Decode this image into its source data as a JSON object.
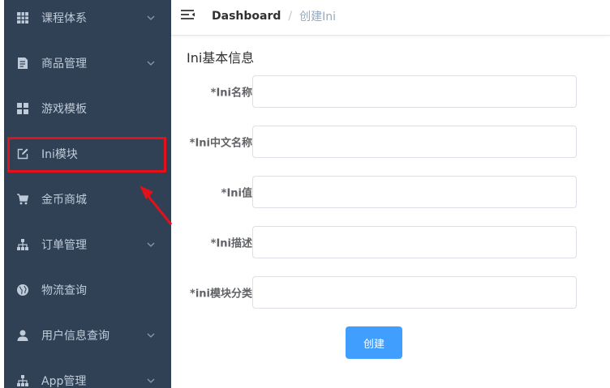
{
  "sidebar": {
    "items": [
      {
        "label": "课程体系",
        "icon": "grid-icon",
        "has_submenu": true
      },
      {
        "label": "商品管理",
        "icon": "document-icon",
        "has_submenu": true
      },
      {
        "label": "游戏模板",
        "icon": "dashboard-icon",
        "has_submenu": false
      },
      {
        "label": "Ini模块",
        "icon": "edit-icon",
        "has_submenu": false,
        "highlighted": true
      },
      {
        "label": "金币商城",
        "icon": "cart-icon",
        "has_submenu": false
      },
      {
        "label": "订单管理",
        "icon": "sitemap-icon",
        "has_submenu": true
      },
      {
        "label": "物流查询",
        "icon": "globe-icon",
        "has_submenu": false
      },
      {
        "label": "用户信息查询",
        "icon": "user-icon",
        "has_submenu": true
      },
      {
        "label": "App管理",
        "icon": "sitemap-icon",
        "has_submenu": true
      }
    ]
  },
  "header": {
    "breadcrumb_home": "Dashboard",
    "breadcrumb_separator": "/",
    "breadcrumb_current": "创建Ini"
  },
  "form": {
    "title": "Ini基本信息",
    "fields": [
      {
        "label": "*Ini名称",
        "value": ""
      },
      {
        "label": "*Ini中文名称",
        "value": ""
      },
      {
        "label": "*Ini值",
        "value": ""
      },
      {
        "label": "*Ini描述",
        "value": ""
      },
      {
        "label": "*ini模块分类",
        "value": ""
      }
    ],
    "submit_label": "创建"
  },
  "colors": {
    "sidebar_bg": "#304156",
    "sidebar_text": "#bfcbd9",
    "primary": "#409eff",
    "annotation_red": "#e5101a"
  }
}
